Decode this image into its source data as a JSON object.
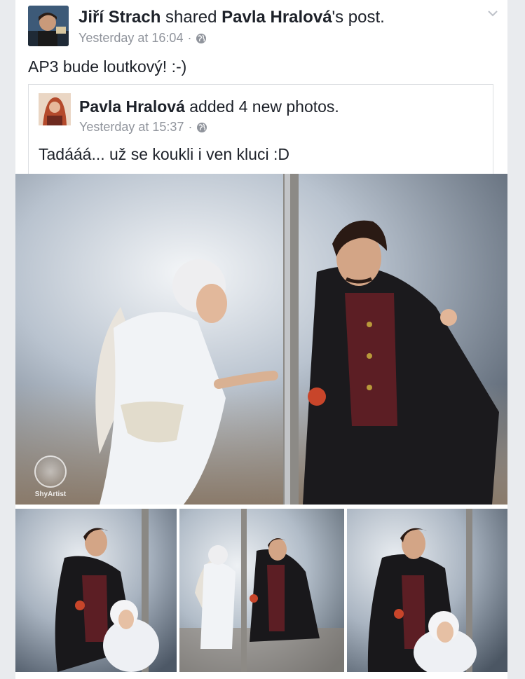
{
  "post": {
    "author": "Jiří Strach",
    "action_mid": " shared ",
    "shared_from": "Pavla Hralová",
    "action_end": "'s post.",
    "timestamp": "Yesterday at 16:04",
    "dot": "·",
    "privacy_icon": "globe-icon",
    "text": "AP3 bude loutkový! :-)"
  },
  "shared": {
    "author": "Pavla Hralová",
    "action": " added 4 new photos.",
    "timestamp": "Yesterday at 15:37",
    "dot": "·",
    "privacy_icon": "globe-icon",
    "text": "Tadááá... už se koukli i ven kluci :D"
  },
  "photos": {
    "watermark": "ShyArtist",
    "items": [
      {
        "subject": "angel-and-man-puppets"
      },
      {
        "subject": "man-puppet-with-angel"
      },
      {
        "subject": "angel-and-man-walking"
      },
      {
        "subject": "man-puppet-with-angel-closeup"
      }
    ]
  },
  "colors": {
    "background": "#e9ebee",
    "card": "#ffffff",
    "text": "#1d2129",
    "meta": "#90949c"
  }
}
